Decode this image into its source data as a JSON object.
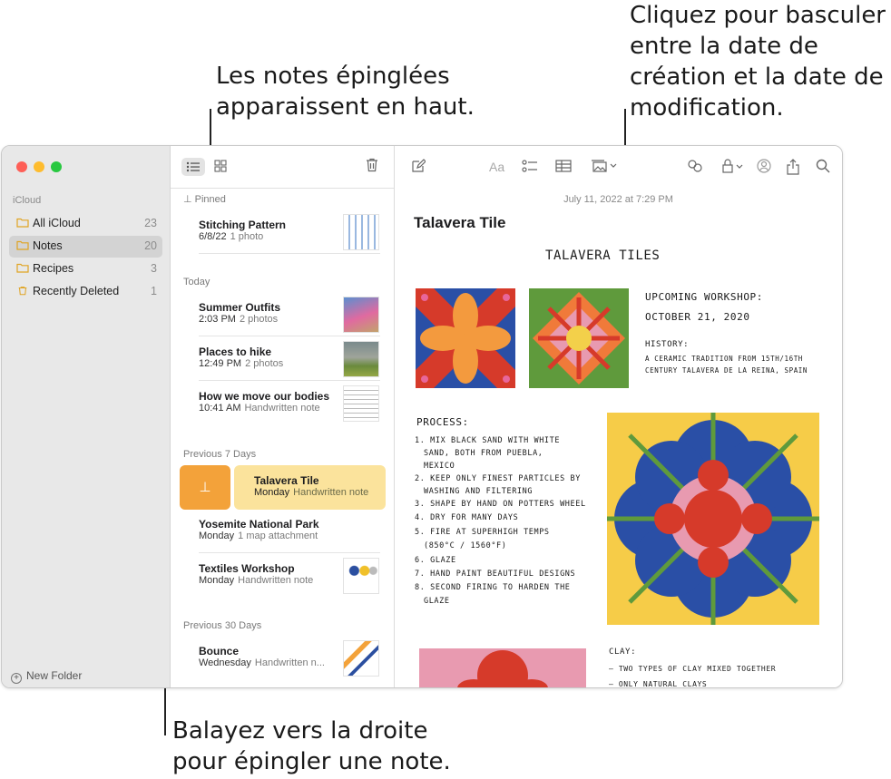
{
  "callouts": {
    "pinned_top": "Les notes épinglées\napparaissent en haut.",
    "toggle_date": "Cliquez pour basculer\nentre la date de\ncréation et la date de\nmodification.",
    "swipe_pin": "Balayez vers la droite\npour épingler une note."
  },
  "colors": {
    "pin_orange": "#f3a23a",
    "selected_note": "#fbe39c",
    "folder_yellow": "#e0a423"
  },
  "sidebar": {
    "section": "iCloud",
    "items": [
      {
        "label": "All iCloud",
        "count": "23",
        "icon": "folder-icon"
      },
      {
        "label": "Notes",
        "count": "20",
        "icon": "folder-icon"
      },
      {
        "label": "Recipes",
        "count": "3",
        "icon": "folder-icon"
      },
      {
        "label": "Recently Deleted",
        "count": "1",
        "icon": "trash-icon"
      }
    ],
    "new_folder": "New Folder"
  },
  "list": {
    "groups": {
      "pinned": "Pinned",
      "today": "Today",
      "prev7": "Previous 7 Days",
      "prev30": "Previous 30 Days"
    },
    "notes": [
      {
        "title": "Stitching Pattern",
        "date": "6/8/22",
        "sub": "1 photo"
      },
      {
        "title": "Summer Outfits",
        "date": "2:03 PM",
        "sub": "2 photos"
      },
      {
        "title": "Places to hike",
        "date": "12:49 PM",
        "sub": "2 photos"
      },
      {
        "title": "How we move our bodies",
        "date": "10:41 AM",
        "sub": "Handwritten note"
      },
      {
        "title": "Talavera Tile",
        "date": "Monday",
        "sub": "Handwritten note"
      },
      {
        "title": "Yosemite National Park",
        "date": "Monday",
        "sub": "1 map attachment"
      },
      {
        "title": "Textiles Workshop",
        "date": "Monday",
        "sub": "Handwritten note"
      },
      {
        "title": "Bounce",
        "date": "Wednesday",
        "sub": "Handwritten n..."
      }
    ]
  },
  "editor": {
    "date": "July 11, 2022 at 7:29 PM",
    "title": "Talavera Tile",
    "format_label": "Aa",
    "hand": {
      "heading": "TALAVERA TILES",
      "workshop1": "UPCOMING WORKSHOP:",
      "workshop2": "OCTOBER 21, 2020",
      "history": "HISTORY:",
      "history1": "A CERAMIC TRADITION FROM 15TH/16TH",
      "history2": "CENTURY TALAVERA DE LA REINA, SPAIN",
      "process": "PROCESS:",
      "p1": "1. MIX BLACK SAND WITH WHITE",
      "p1b": "SAND, BOTH FROM PUEBLA,",
      "p1c": "MEXICO",
      "p2": "2. KEEP ONLY FINEST PARTICLES BY",
      "p2b": "WASHING AND FILTERING",
      "p3": "3. SHAPE BY HAND ON POTTERS WHEEL",
      "p4": "4. DRY FOR MANY DAYS",
      "p5": "5. FIRE AT SUPERHIGH TEMPS",
      "p5b": "(850°C / 1560°F)",
      "p6": "6. GLAZE",
      "p7": "7. HAND PAINT BEAUTIFUL DESIGNS",
      "p8": "8. SECOND FIRING TO HARDEN THE",
      "p8b": "GLAZE",
      "clay": "CLAY:",
      "clay1": "— TWO TYPES OF CLAY MIXED TOGETHER",
      "clay2": "— ONLY NATURAL CLAYS"
    }
  }
}
